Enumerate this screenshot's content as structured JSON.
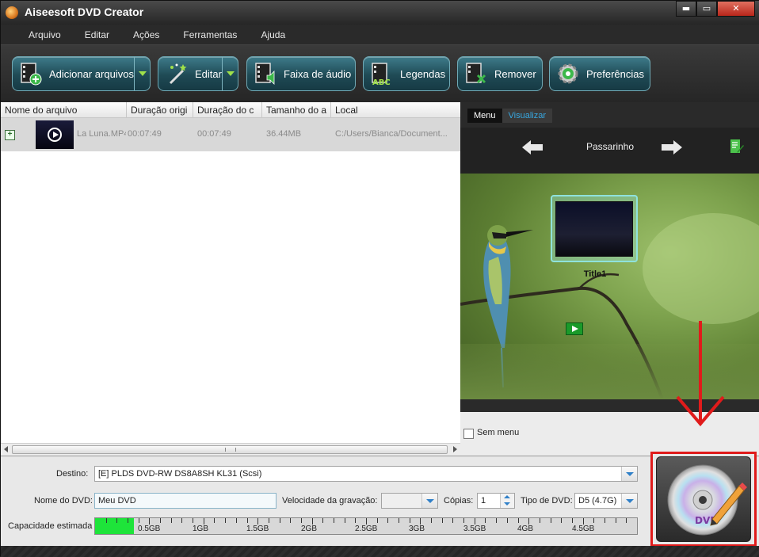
{
  "window": {
    "title": "Aiseesoft DVD Creator",
    "close_label": "✕",
    "maximize_label": "▭",
    "minimize_label": "▬"
  },
  "menu": [
    "Arquivo",
    "Editar",
    "Ações",
    "Ferramentas",
    "Ajuda"
  ],
  "toolbar": {
    "add_label": "Adicionar arquivos",
    "edit_label": "Editar",
    "audio_label": "Faixa de áudio",
    "subtitles_label": "Legendas",
    "remove_label": "Remover",
    "prefs_label": "Preferências"
  },
  "file_table": {
    "columns": [
      "Nome do arquivo",
      "Duração origi",
      "Duração do c",
      "Tamanho do a",
      "Local"
    ],
    "rows": [
      {
        "name": "La Luna.MP4",
        "orig_duration": "00:07:49",
        "out_duration": "00:07:49",
        "size": "36.44MB",
        "location": "C:/Users/Bianca/Document..."
      }
    ]
  },
  "preview": {
    "tab_menu": "Menu",
    "tab_visualizar": "Visualizar",
    "template_name": "Passarinho",
    "title_label": "Title1",
    "no_menu_label": "Sem menu"
  },
  "settings": {
    "destino_label": "Destino:",
    "destino_value": "[E] PLDS DVD-RW DS8A8SH KL31 (Scsi)",
    "dvd_name_label": "Nome do DVD:",
    "dvd_name_value": "Meu DVD",
    "speed_label": "Velocidade da gravação:",
    "speed_value": "",
    "copies_label": "Cópias:",
    "copies_value": "1",
    "dvd_type_label": "Tipo de DVD:",
    "dvd_type_value": "D5 (4.7G)",
    "capacity_label": "Capacidade estimada",
    "capacity_used_gb": 0.36,
    "capacity_max_gb": 5,
    "capacity_ticks": [
      "0.5GB",
      "1GB",
      "1.5GB",
      "2GB",
      "2.5GB",
      "3GB",
      "3.5GB",
      "4GB",
      "4.5GB"
    ]
  },
  "colors": {
    "toolbar_button": "#1f4a55",
    "accent_green": "#1ee43a",
    "highlight_red": "#e01b1b",
    "tab_active_text": "#37a7e0"
  }
}
